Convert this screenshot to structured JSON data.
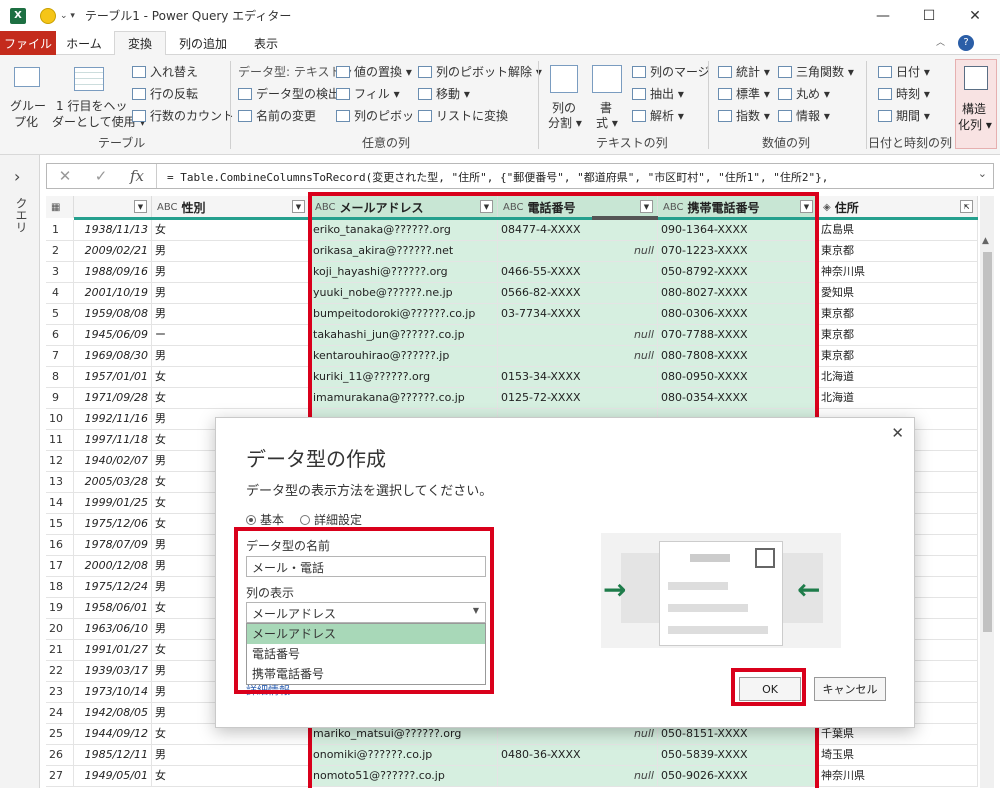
{
  "window": {
    "title": "テーブル1 - Power Query エディター",
    "xl_icon": "X",
    "qat": "⌄ ▾"
  },
  "tabs": [
    "ファイル",
    "ホーム",
    "変換",
    "列の追加",
    "表示"
  ],
  "ribbon": {
    "table_group": {
      "label": "テーブル",
      "btn_group": "グループ化",
      "btn_group_l1": "グルー",
      "btn_group_l2": "プ化",
      "btn_first_row_l1": "1 行目をヘッ",
      "btn_first_row_l2": "ダーとして使用 ▾",
      "swap": "入れ替え",
      "reverse": "行の反転",
      "count": "行数のカウント"
    },
    "any_col": {
      "label": "任意の列",
      "data_type": "データ型: テキスト ▾",
      "detect": "データ型の検出",
      "rename": "名前の変更",
      "replace": "値の置換 ▾",
      "fill": "フィル ▾",
      "pivot": "列のピボット",
      "unpivot": "列のピボット解除 ▾",
      "move": "移動 ▾",
      "to_list": "リストに変換"
    },
    "text_col": {
      "label": "テキストの列",
      "split_l1": "列の",
      "split_l2": "分割 ▾",
      "format_l1": "書",
      "format_l2": "式 ▾",
      "merge": "列のマージ",
      "extract": "抽出 ▾",
      "parse": "解析 ▾"
    },
    "num_col": {
      "label": "数値の列",
      "stats": "統計 ▾",
      "standard": "標準 ▾",
      "sci": "指数 ▾",
      "trig": "三角関数 ▾",
      "round": "丸め ▾",
      "info": "情報 ▾"
    },
    "date_col": {
      "label": "日付と時刻の列",
      "date": "日付 ▾",
      "time": "時刻 ▾",
      "duration": "期間 ▾"
    },
    "struct": {
      "l1": "構造",
      "l2": "化列 ▾"
    }
  },
  "sidebar": {
    "chevron": "›",
    "label": "クエリ"
  },
  "formula": {
    "cancel": "✕",
    "confirm": "✓",
    "fx": "fx",
    "text": "= Table.CombineColumnsToRecord(変更された型, \"住所\", {\"郵便番号\", \"都道府県\", \"市区町村\", \"住所1\", \"住所2\"},"
  },
  "columns": [
    {
      "name": "",
      "type": "▦"
    },
    {
      "name": "",
      "type": ""
    },
    {
      "name": "性別",
      "type": "ABC"
    },
    {
      "name": "メールアドレス",
      "type": "ABC"
    },
    {
      "name": "電話番号",
      "type": "ABC"
    },
    {
      "name": "携帯電話番号",
      "type": "ABC"
    },
    {
      "name": "住所",
      "type": "◈"
    }
  ],
  "rows": [
    {
      "n": "1",
      "date": "1938/11/13",
      "sex": "女",
      "mail": "eriko_tanaka@??????.org",
      "tel": "08477-4-XXXX",
      "mob": "090-1364-XXXX",
      "addr": "広島県"
    },
    {
      "n": "2",
      "date": "2009/02/21",
      "sex": "男",
      "mail": "orikasa_akira@??????.net",
      "tel": "null",
      "mob": "070-1223-XXXX",
      "addr": "東京都"
    },
    {
      "n": "3",
      "date": "1988/09/16",
      "sex": "男",
      "mail": "koji_hayashi@??????.org",
      "tel": "0466-55-XXXX",
      "mob": "050-8792-XXXX",
      "addr": "神奈川県"
    },
    {
      "n": "4",
      "date": "2001/10/19",
      "sex": "男",
      "mail": "yuuki_nobe@??????.ne.jp",
      "tel": "0566-82-XXXX",
      "mob": "080-8027-XXXX",
      "addr": "愛知県"
    },
    {
      "n": "5",
      "date": "1959/08/08",
      "sex": "男",
      "mail": "bumpeitodoroki@??????.co.jp",
      "tel": "03-7734-XXXX",
      "mob": "080-0306-XXXX",
      "addr": "東京都"
    },
    {
      "n": "6",
      "date": "1945/06/09",
      "sex": "ー",
      "mail": "takahashi_jun@??????.co.jp",
      "tel": "null",
      "mob": "070-7788-XXXX",
      "addr": "東京都"
    },
    {
      "n": "7",
      "date": "1969/08/30",
      "sex": "男",
      "mail": "kentarouhirao@??????.jp",
      "tel": "null",
      "mob": "080-7808-XXXX",
      "addr": "東京都"
    },
    {
      "n": "8",
      "date": "1957/01/01",
      "sex": "女",
      "mail": "kuriki_11@??????.org",
      "tel": "0153-34-XXXX",
      "mob": "080-0950-XXXX",
      "addr": "北海道"
    },
    {
      "n": "9",
      "date": "1971/09/28",
      "sex": "女",
      "mail": "imamurakana@??????.co.jp",
      "tel": "0125-72-XXXX",
      "mob": "080-0354-XXXX",
      "addr": "北海道"
    },
    {
      "n": "10",
      "date": "1992/11/16",
      "sex": "男",
      "mail": "",
      "tel": "",
      "mob": "",
      "addr": ""
    },
    {
      "n": "11",
      "date": "1997/11/18",
      "sex": "女",
      "mail": "",
      "tel": "",
      "mob": "",
      "addr": ""
    },
    {
      "n": "12",
      "date": "1940/02/07",
      "sex": "男",
      "mail": "",
      "tel": "",
      "mob": "",
      "addr": ""
    },
    {
      "n": "13",
      "date": "2005/03/28",
      "sex": "女",
      "mail": "",
      "tel": "",
      "mob": "",
      "addr": ""
    },
    {
      "n": "14",
      "date": "1999/01/25",
      "sex": "女",
      "mail": "",
      "tel": "",
      "mob": "",
      "addr": ""
    },
    {
      "n": "15",
      "date": "1975/12/06",
      "sex": "女",
      "mail": "",
      "tel": "",
      "mob": "",
      "addr": ""
    },
    {
      "n": "16",
      "date": "1978/07/09",
      "sex": "男",
      "mail": "",
      "tel": "",
      "mob": "",
      "addr": ""
    },
    {
      "n": "17",
      "date": "2000/12/08",
      "sex": "男",
      "mail": "",
      "tel": "",
      "mob": "",
      "addr": ""
    },
    {
      "n": "18",
      "date": "1975/12/24",
      "sex": "男",
      "mail": "",
      "tel": "",
      "mob": "",
      "addr": ""
    },
    {
      "n": "19",
      "date": "1958/06/01",
      "sex": "女",
      "mail": "",
      "tel": "",
      "mob": "",
      "addr": ""
    },
    {
      "n": "20",
      "date": "1963/06/10",
      "sex": "男",
      "mail": "",
      "tel": "",
      "mob": "",
      "addr": ""
    },
    {
      "n": "21",
      "date": "1991/01/27",
      "sex": "女",
      "mail": "",
      "tel": "",
      "mob": "",
      "addr": ""
    },
    {
      "n": "22",
      "date": "1939/03/17",
      "sex": "男",
      "mail": "",
      "tel": "",
      "mob": "",
      "addr": ""
    },
    {
      "n": "23",
      "date": "1973/10/14",
      "sex": "男",
      "mail": "",
      "tel": "",
      "mob": "",
      "addr": ""
    },
    {
      "n": "24",
      "date": "1942/08/05",
      "sex": "男",
      "mail": "",
      "tel": "",
      "mob": "",
      "addr": ""
    },
    {
      "n": "25",
      "date": "1944/09/12",
      "sex": "女",
      "mail": "mariko_matsui@??????.org",
      "tel": "null",
      "mob": "050-8151-XXXX",
      "addr": "千葉県"
    },
    {
      "n": "26",
      "date": "1985/12/11",
      "sex": "男",
      "mail": "onomiki@??????.co.jp",
      "tel": "0480-36-XXXX",
      "mob": "050-5839-XXXX",
      "addr": "埼玉県"
    },
    {
      "n": "27",
      "date": "1949/05/01",
      "sex": "女",
      "mail": "nomoto51@??????.co.jp",
      "tel": "null",
      "mob": "050-9026-XXXX",
      "addr": "神奈川県"
    }
  ],
  "dialog": {
    "title": "データ型の作成",
    "desc": "データ型の表示方法を選択してください。",
    "radio_basic": "基本",
    "radio_adv": "詳細設定",
    "name_label": "データ型の名前",
    "name_value": "メール・電話",
    "display_label": "列の表示",
    "display_value": "メールアドレス",
    "options": [
      "メールアドレス",
      "電話番号",
      "携帯電話番号"
    ],
    "link": "詳細情報",
    "ok": "OK",
    "cancel": "キャンセル",
    "close": "✕"
  },
  "colors": {
    "accent": "#25a08e",
    "highlight": "#d9001b",
    "file_tab": "#c42b1c"
  }
}
